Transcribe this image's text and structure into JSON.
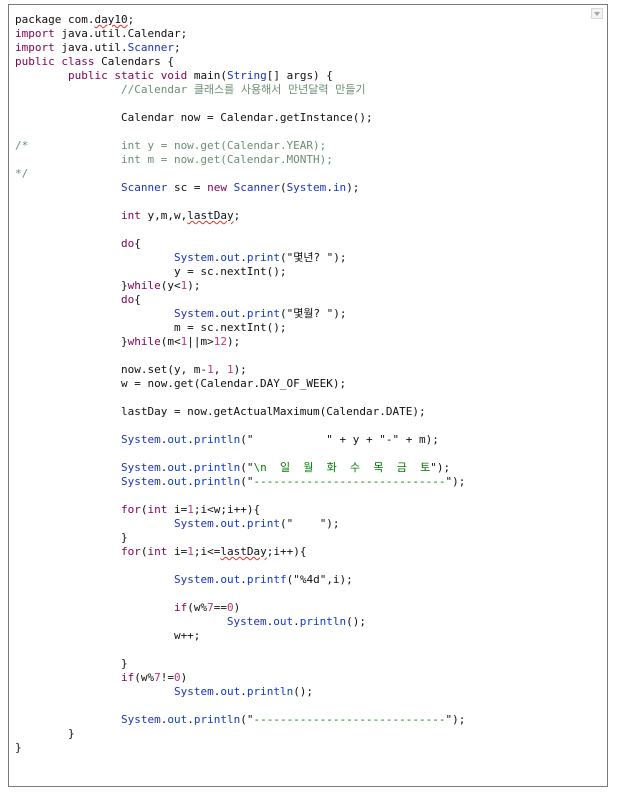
{
  "code_lines": [
    [
      {
        "t": "package com.",
        "c": "plain"
      },
      {
        "t": "day10",
        "c": "plain",
        "err": true
      },
      {
        "t": ";",
        "c": "plain"
      }
    ],
    [
      {
        "t": "import",
        "c": "kw"
      },
      {
        "t": " java.util.Calendar;",
        "c": "plain"
      }
    ],
    [
      {
        "t": "import",
        "c": "kw"
      },
      {
        "t": " java.util.",
        "c": "plain"
      },
      {
        "t": "Scanner",
        "c": "ty"
      },
      {
        "t": ";",
        "c": "plain"
      }
    ],
    [
      {
        "t": "public class",
        "c": "kw"
      },
      {
        "t": " Calendars {",
        "c": "plain"
      }
    ],
    [
      {
        "t": "        ",
        "c": "plain"
      },
      {
        "t": "public static void",
        "c": "kw"
      },
      {
        "t": " main(",
        "c": "plain"
      },
      {
        "t": "String",
        "c": "ty"
      },
      {
        "t": "[] args) {",
        "c": "plain"
      }
    ],
    [
      {
        "t": "                ",
        "c": "plain"
      },
      {
        "t": "//Calendar 클래스를 사용해서 만년달력 만들기",
        "c": "cm"
      }
    ],
    [],
    [
      {
        "t": "                Calendar now = Calendar.getInstance();",
        "c": "plain"
      }
    ],
    [],
    [
      {
        "t": "/*              int y = now.get(Calendar.YEAR);",
        "c": "cm"
      }
    ],
    [
      {
        "t": "                int m = now.get(Calendar.MONTH);",
        "c": "cm"
      }
    ],
    [
      {
        "t": "*/",
        "c": "cm"
      }
    ],
    [
      {
        "t": "                ",
        "c": "plain"
      },
      {
        "t": "Scanner",
        "c": "ty"
      },
      {
        "t": " sc = ",
        "c": "plain"
      },
      {
        "t": "new",
        "c": "kw"
      },
      {
        "t": " ",
        "c": "plain"
      },
      {
        "t": "Scanner",
        "c": "ty"
      },
      {
        "t": "(",
        "c": "plain"
      },
      {
        "t": "System",
        "c": "ty"
      },
      {
        "t": ".",
        "c": "plain"
      },
      {
        "t": "in",
        "c": "fd"
      },
      {
        "t": ");",
        "c": "plain"
      }
    ],
    [],
    [
      {
        "t": "                ",
        "c": "plain"
      },
      {
        "t": "int",
        "c": "kw"
      },
      {
        "t": " y,m,w,",
        "c": "plain"
      },
      {
        "t": "lastDay",
        "c": "plain",
        "err": true
      },
      {
        "t": ";",
        "c": "plain"
      }
    ],
    [],
    [
      {
        "t": "                ",
        "c": "plain"
      },
      {
        "t": "do",
        "c": "kw"
      },
      {
        "t": "{",
        "c": "plain"
      }
    ],
    [
      {
        "t": "                        ",
        "c": "plain"
      },
      {
        "t": "System",
        "c": "ty"
      },
      {
        "t": ".",
        "c": "plain"
      },
      {
        "t": "out",
        "c": "fd"
      },
      {
        "t": ".",
        "c": "plain"
      },
      {
        "t": "print",
        "c": "fd"
      },
      {
        "t": "(\"몇년? \");",
        "c": "plain"
      }
    ],
    [
      {
        "t": "                        y = sc.nextInt();",
        "c": "plain"
      }
    ],
    [
      {
        "t": "                }",
        "c": "plain"
      },
      {
        "t": "while",
        "c": "kw"
      },
      {
        "t": "(y<",
        "c": "plain"
      },
      {
        "t": "1",
        "c": "nm"
      },
      {
        "t": ");",
        "c": "plain"
      }
    ],
    [
      {
        "t": "                ",
        "c": "plain"
      },
      {
        "t": "do",
        "c": "kw"
      },
      {
        "t": "{",
        "c": "plain"
      }
    ],
    [
      {
        "t": "                        ",
        "c": "plain"
      },
      {
        "t": "System",
        "c": "ty"
      },
      {
        "t": ".",
        "c": "plain"
      },
      {
        "t": "out",
        "c": "fd"
      },
      {
        "t": ".",
        "c": "plain"
      },
      {
        "t": "print",
        "c": "fd"
      },
      {
        "t": "(\"몇월? \");",
        "c": "plain"
      }
    ],
    [
      {
        "t": "                        m = sc.nextInt();",
        "c": "plain"
      }
    ],
    [
      {
        "t": "                }",
        "c": "plain"
      },
      {
        "t": "while",
        "c": "kw"
      },
      {
        "t": "(m<",
        "c": "plain"
      },
      {
        "t": "1",
        "c": "nm"
      },
      {
        "t": "||m>",
        "c": "plain"
      },
      {
        "t": "12",
        "c": "nm"
      },
      {
        "t": ");",
        "c": "plain"
      }
    ],
    [],
    [
      {
        "t": "                now.set(y, m-",
        "c": "plain"
      },
      {
        "t": "1",
        "c": "nm"
      },
      {
        "t": ", ",
        "c": "plain"
      },
      {
        "t": "1",
        "c": "nm"
      },
      {
        "t": ");",
        "c": "plain"
      }
    ],
    [
      {
        "t": "                w = now.get(Calendar.",
        "c": "plain"
      },
      {
        "t": "DAY_OF_WEEK",
        "c": "plain",
        "err": false
      },
      {
        "t": ");",
        "c": "plain"
      }
    ],
    [],
    [
      {
        "t": "                lastDay = now.getActualMaximum(Calendar.DATE);",
        "c": "plain"
      }
    ],
    [],
    [
      {
        "t": "                ",
        "c": "plain"
      },
      {
        "t": "System",
        "c": "ty"
      },
      {
        "t": ".",
        "c": "plain"
      },
      {
        "t": "out",
        "c": "fd"
      },
      {
        "t": ".",
        "c": "plain"
      },
      {
        "t": "println",
        "c": "fd"
      },
      {
        "t": "(\"           \" + y + \"-\" + m);",
        "c": "plain"
      }
    ],
    [],
    [
      {
        "t": "                ",
        "c": "plain"
      },
      {
        "t": "System",
        "c": "ty"
      },
      {
        "t": ".",
        "c": "plain"
      },
      {
        "t": "out",
        "c": "fd"
      },
      {
        "t": ".",
        "c": "plain"
      },
      {
        "t": "println",
        "c": "fd"
      },
      {
        "t": "(\"",
        "c": "plain"
      },
      {
        "t": "\\n  일  월  화  수  목  금  토",
        "c": "st"
      },
      {
        "t": "\");",
        "c": "plain"
      }
    ],
    [
      {
        "t": "                ",
        "c": "plain"
      },
      {
        "t": "System",
        "c": "ty"
      },
      {
        "t": ".",
        "c": "plain"
      },
      {
        "t": "out",
        "c": "fd"
      },
      {
        "t": ".",
        "c": "plain"
      },
      {
        "t": "println",
        "c": "fd"
      },
      {
        "t": "(\"",
        "c": "plain"
      },
      {
        "t": "-----------------------------",
        "c": "st"
      },
      {
        "t": "\");",
        "c": "plain"
      }
    ],
    [],
    [
      {
        "t": "                ",
        "c": "plain"
      },
      {
        "t": "for",
        "c": "kw"
      },
      {
        "t": "(",
        "c": "plain"
      },
      {
        "t": "int",
        "c": "kw"
      },
      {
        "t": " i=",
        "c": "plain"
      },
      {
        "t": "1",
        "c": "nm"
      },
      {
        "t": ";i<w;i++){",
        "c": "plain"
      }
    ],
    [
      {
        "t": "                        ",
        "c": "plain"
      },
      {
        "t": "System",
        "c": "ty"
      },
      {
        "t": ".",
        "c": "plain"
      },
      {
        "t": "out",
        "c": "fd"
      },
      {
        "t": ".",
        "c": "plain"
      },
      {
        "t": "print",
        "c": "fd"
      },
      {
        "t": "(\"    \");",
        "c": "plain"
      }
    ],
    [
      {
        "t": "                }",
        "c": "plain"
      }
    ],
    [
      {
        "t": "                ",
        "c": "plain"
      },
      {
        "t": "for",
        "c": "kw"
      },
      {
        "t": "(",
        "c": "plain"
      },
      {
        "t": "int",
        "c": "kw"
      },
      {
        "t": " i=",
        "c": "plain"
      },
      {
        "t": "1",
        "c": "nm"
      },
      {
        "t": ";i<=",
        "c": "plain"
      },
      {
        "t": "lastDay",
        "c": "plain",
        "err": true
      },
      {
        "t": ";i++){",
        "c": "plain"
      }
    ],
    [],
    [
      {
        "t": "                        ",
        "c": "plain"
      },
      {
        "t": "System",
        "c": "ty"
      },
      {
        "t": ".",
        "c": "plain"
      },
      {
        "t": "out",
        "c": "fd"
      },
      {
        "t": ".",
        "c": "plain"
      },
      {
        "t": "printf",
        "c": "fd"
      },
      {
        "t": "(\"%4d\",i);",
        "c": "plain"
      }
    ],
    [],
    [
      {
        "t": "                        ",
        "c": "plain"
      },
      {
        "t": "if",
        "c": "kw"
      },
      {
        "t": "(w%",
        "c": "plain"
      },
      {
        "t": "7",
        "c": "nm"
      },
      {
        "t": "==",
        "c": "plain"
      },
      {
        "t": "0",
        "c": "nm"
      },
      {
        "t": ")",
        "c": "plain"
      }
    ],
    [
      {
        "t": "                                ",
        "c": "plain"
      },
      {
        "t": "System",
        "c": "ty"
      },
      {
        "t": ".",
        "c": "plain"
      },
      {
        "t": "out",
        "c": "fd"
      },
      {
        "t": ".",
        "c": "plain"
      },
      {
        "t": "println",
        "c": "fd"
      },
      {
        "t": "();",
        "c": "plain"
      }
    ],
    [
      {
        "t": "                        w++;",
        "c": "plain"
      }
    ],
    [],
    [
      {
        "t": "                }",
        "c": "plain"
      }
    ],
    [
      {
        "t": "                ",
        "c": "plain"
      },
      {
        "t": "if",
        "c": "kw"
      },
      {
        "t": "(w%",
        "c": "plain"
      },
      {
        "t": "7",
        "c": "nm"
      },
      {
        "t": "!=",
        "c": "plain"
      },
      {
        "t": "0",
        "c": "nm"
      },
      {
        "t": ")",
        "c": "plain"
      }
    ],
    [
      {
        "t": "                        ",
        "c": "plain"
      },
      {
        "t": "System",
        "c": "ty"
      },
      {
        "t": ".",
        "c": "plain"
      },
      {
        "t": "out",
        "c": "fd"
      },
      {
        "t": ".",
        "c": "plain"
      },
      {
        "t": "println",
        "c": "fd"
      },
      {
        "t": "();",
        "c": "plain"
      }
    ],
    [],
    [
      {
        "t": "                ",
        "c": "plain"
      },
      {
        "t": "System",
        "c": "ty"
      },
      {
        "t": ".",
        "c": "plain"
      },
      {
        "t": "out",
        "c": "fd"
      },
      {
        "t": ".",
        "c": "plain"
      },
      {
        "t": "println",
        "c": "fd"
      },
      {
        "t": "(\"",
        "c": "plain"
      },
      {
        "t": "-----------------------------",
        "c": "st"
      },
      {
        "t": "\");",
        "c": "plain"
      }
    ],
    [
      {
        "t": "        }",
        "c": "plain"
      }
    ],
    [
      {
        "t": "}",
        "c": "plain"
      }
    ]
  ],
  "colors": {
    "keyword": "#7f0055",
    "type": "#1a33b8",
    "field": "#0d3cc3",
    "number": "#c0357c",
    "string": "#007a00",
    "comment": "#6b8e73",
    "error_underline": "#e0302a"
  },
  "icons": {
    "dropdown": "chevron-down-icon"
  }
}
